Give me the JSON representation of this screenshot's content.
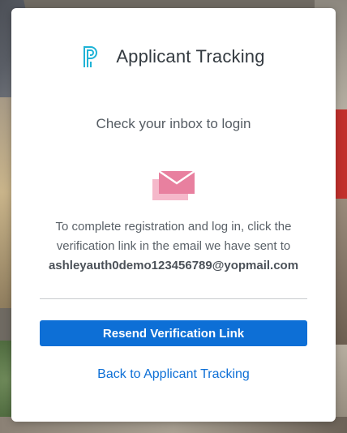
{
  "app": {
    "title": "Applicant Tracking",
    "logo_icon": "powerschool-p-logo-icon",
    "brand_color": "#1fb3d6"
  },
  "main": {
    "subtitle": "Check your inbox to login",
    "mail_icon": "envelope-icon",
    "message_line1": "To complete registration and log in, click the",
    "message_line2": "verification link in the email we have sent to",
    "email": "ashleyauth0demo123456789@yopmail.com"
  },
  "actions": {
    "resend_label": "Resend Verification Link",
    "back_label": "Back to Applicant Tracking",
    "accent_color": "#0d6fd6"
  }
}
